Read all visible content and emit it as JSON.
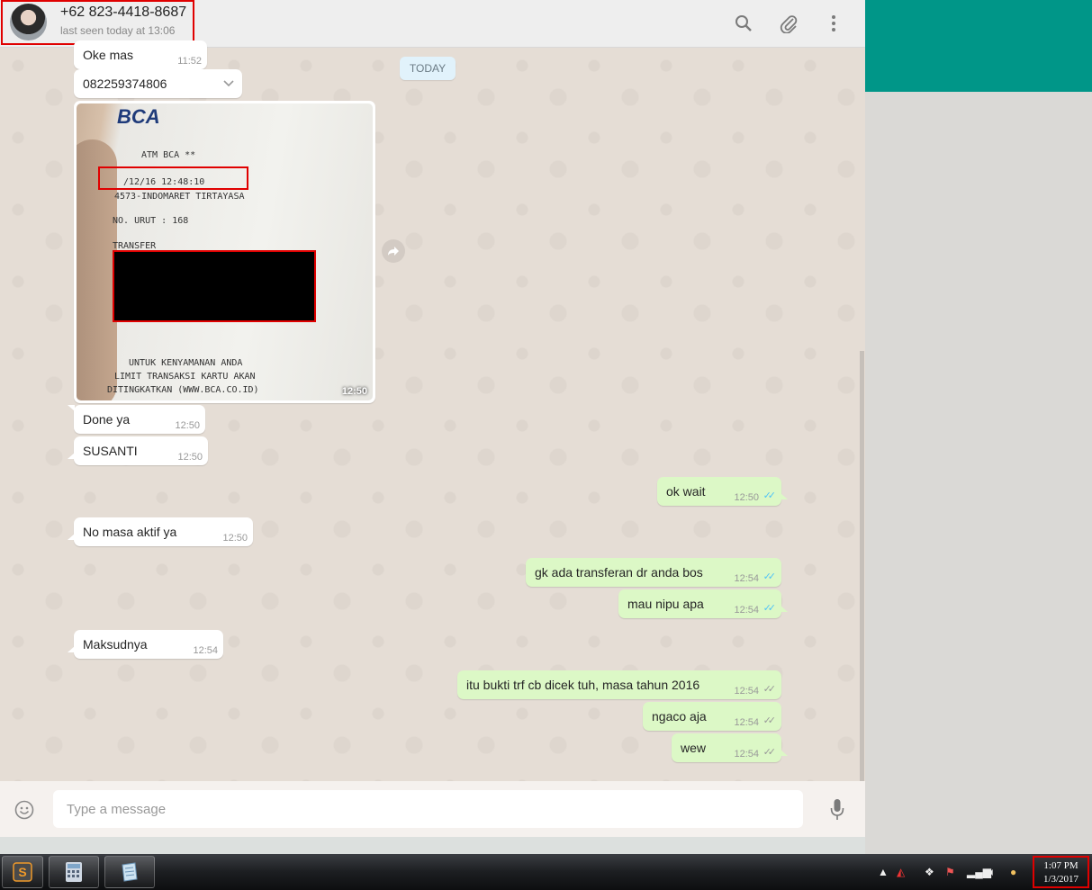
{
  "header": {
    "contact_name": "+62 823-4418-8687",
    "status": "last seen today at 13:06",
    "icons": [
      "search-icon",
      "attach-icon",
      "menu-icon"
    ]
  },
  "day_divider": "TODAY",
  "messages": [
    {
      "id": "m1",
      "direction": "in",
      "text": "Oke mas",
      "time": "11:52"
    },
    {
      "id": "m2",
      "direction": "in",
      "text": "082259374806",
      "time": ""
    },
    {
      "id": "m3",
      "direction": "in",
      "type": "image",
      "time": "12:50"
    },
    {
      "id": "m4",
      "direction": "in",
      "text": "Done ya",
      "time": "12:50"
    },
    {
      "id": "m5",
      "direction": "in",
      "text": "SUSANTI",
      "time": "12:50"
    },
    {
      "id": "m6",
      "direction": "out",
      "text": "ok wait",
      "time": "12:50",
      "status": "read"
    },
    {
      "id": "m7",
      "direction": "in",
      "text": "No masa aktif ya",
      "time": "12:50"
    },
    {
      "id": "m8",
      "direction": "out",
      "text": "gk ada transferan dr anda bos",
      "time": "12:54",
      "status": "read"
    },
    {
      "id": "m9",
      "direction": "out",
      "text": "mau nipu apa",
      "time": "12:54",
      "status": "read"
    },
    {
      "id": "m10",
      "direction": "in",
      "text": "Maksudnya",
      "time": "12:54"
    },
    {
      "id": "m11",
      "direction": "out",
      "text": "itu bukti trf cb dicek tuh, masa tahun 2016",
      "time": "12:54",
      "status": "delivered"
    },
    {
      "id": "m12",
      "direction": "out",
      "text": "ngaco aja",
      "time": "12:54",
      "status": "delivered"
    },
    {
      "id": "m13",
      "direction": "out",
      "text": "wew",
      "time": "12:54",
      "status": "delivered"
    }
  ],
  "receipt": {
    "bank": "BCA",
    "line1": "ATM BCA  **",
    "line2": "/12/16    12:48:10",
    "line3": "4573-INDOMARET TIRTAYASA",
    "line4": "NO. URUT : 168",
    "line5": "TRANSFER",
    "footer1": "UNTUK KENYAMANAN ANDA",
    "footer2": "LIMIT TRANSAKSI KARTU AKAN",
    "footer3": "DITINGKATKAN (WWW.BCA.CO.ID)"
  },
  "composer": {
    "placeholder": "Type a message"
  },
  "taskbar": {
    "clock_time": "1:07 PM",
    "clock_date": "1/3/2017"
  },
  "colors": {
    "header_bg": "#eeeeee",
    "chat_bg": "#e5ddd5",
    "incoming_bubble": "#ffffff",
    "outgoing_bubble": "#dcf8c6",
    "accent_teal": "#009688",
    "read_tick": "#4fc3f7",
    "highlight_red": "#e00000"
  }
}
